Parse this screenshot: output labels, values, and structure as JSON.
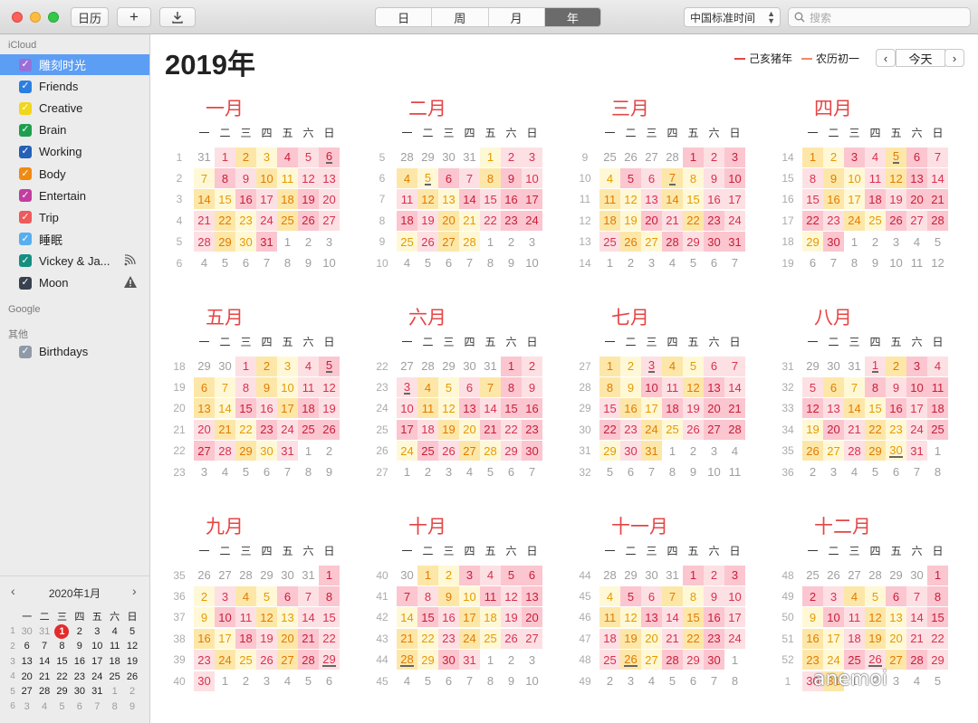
{
  "toolbar": {
    "calendars_label": "日历",
    "add_label": "+",
    "views": [
      "日",
      "周",
      "月",
      "年"
    ],
    "active_view": "年",
    "timezone": "中国标准时间",
    "search_placeholder": "搜索"
  },
  "sidebar": {
    "sections": [
      {
        "title": "iCloud",
        "items": [
          {
            "label": "雕刻时光",
            "color": "#9b6fd8",
            "selected": true
          },
          {
            "label": "Friends",
            "color": "#2b7fe0"
          },
          {
            "label": "Creative",
            "color": "#f2d61b"
          },
          {
            "label": "Brain",
            "color": "#1f9e50"
          },
          {
            "label": "Working",
            "color": "#2560b8"
          },
          {
            "label": "Body",
            "color": "#f08a12"
          },
          {
            "label": "Entertain",
            "color": "#c23d9f"
          },
          {
            "label": "Trip",
            "color": "#ef5a5a"
          },
          {
            "label": "睡眠",
            "color": "#57aef0"
          },
          {
            "label": "Vickey & Ja...",
            "color": "#158f80",
            "extra": "shared-icon"
          },
          {
            "label": "Moon",
            "color": "#38414f",
            "extra": "warning-icon"
          }
        ]
      },
      {
        "title": "Google",
        "items": []
      },
      {
        "title": "其他",
        "items": [
          {
            "label": "Birthdays",
            "color": "#8f9aa8"
          }
        ]
      }
    ]
  },
  "mini_calendar": {
    "title": "2020年1月",
    "weekday_headers": [
      "一",
      "二",
      "三",
      "四",
      "五",
      "六",
      "日"
    ],
    "rows": [
      {
        "week": "1",
        "days": [
          "30",
          "31",
          "1",
          "2",
          "3",
          "4",
          "5"
        ],
        "other": [
          0,
          1
        ]
      },
      {
        "week": "2",
        "days": [
          "6",
          "7",
          "8",
          "9",
          "10",
          "11",
          "12"
        ],
        "other": []
      },
      {
        "week": "3",
        "days": [
          "13",
          "14",
          "15",
          "16",
          "17",
          "18",
          "19"
        ],
        "other": []
      },
      {
        "week": "4",
        "days": [
          "20",
          "21",
          "22",
          "23",
          "24",
          "25",
          "26"
        ],
        "other": []
      },
      {
        "week": "5",
        "days": [
          "27",
          "28",
          "29",
          "30",
          "31",
          "1",
          "2"
        ],
        "other": [
          5,
          6
        ]
      },
      {
        "week": "6",
        "days": [
          "3",
          "4",
          "5",
          "6",
          "7",
          "8",
          "9"
        ],
        "other": [
          0,
          1,
          2,
          3,
          4,
          5,
          6
        ]
      }
    ],
    "today": "1"
  },
  "main": {
    "year_title": "2019年",
    "legend": [
      {
        "label": "己亥猪年",
        "color": "#e64545"
      },
      {
        "label": "农历初一",
        "color": "#f08a6a"
      }
    ],
    "today_label": "今天",
    "prev_label": "‹",
    "next_label": "›"
  },
  "months": [
    {
      "title": "一月",
      "first_week": 1,
      "lead": 1,
      "days": 31,
      "prev_days": 31
    },
    {
      "title": "二月",
      "first_week": 5,
      "lead": 4,
      "days": 28,
      "prev_days": 31
    },
    {
      "title": "三月",
      "first_week": 9,
      "lead": 4,
      "days": 31,
      "prev_days": 28
    },
    {
      "title": "四月",
      "first_week": 14,
      "lead": 0,
      "days": 30,
      "prev_days": 31
    },
    {
      "title": "五月",
      "first_week": 18,
      "lead": 2,
      "days": 31,
      "prev_days": 30
    },
    {
      "title": "六月",
      "first_week": 22,
      "lead": 5,
      "days": 30,
      "prev_days": 31
    },
    {
      "title": "七月",
      "first_week": 27,
      "lead": 0,
      "days": 31,
      "prev_days": 30
    },
    {
      "title": "八月",
      "first_week": 31,
      "lead": 3,
      "days": 31,
      "prev_days": 31
    },
    {
      "title": "九月",
      "first_week": 35,
      "lead": 6,
      "days": 30,
      "prev_days": 31
    },
    {
      "title": "十月",
      "first_week": 40,
      "lead": 1,
      "days": 31,
      "prev_days": 30
    },
    {
      "title": "十一月",
      "first_week": 44,
      "lead": 4,
      "days": 30,
      "prev_days": 31
    },
    {
      "title": "十二月",
      "first_week": 48,
      "lead": 6,
      "days": 31,
      "prev_days": 30
    }
  ],
  "weekday_headers": [
    "一",
    "二",
    "三",
    "四",
    "五",
    "六",
    "日"
  ],
  "lunar_first_days": {
    "1": [
      6
    ],
    "2": [
      5
    ],
    "3": [
      7
    ],
    "4": [
      5
    ],
    "5": [
      5
    ],
    "6": [
      3
    ],
    "7": [
      3
    ],
    "8": [
      1,
      30
    ],
    "9": [
      29
    ],
    "10": [
      28
    ],
    "11": [
      26
    ],
    "12": [
      26
    ]
  },
  "heat_colors": [
    "#fff8d6",
    "#fde7a8",
    "#fde0e3",
    "#fbc6cf"
  ],
  "watermark": "anemoi"
}
